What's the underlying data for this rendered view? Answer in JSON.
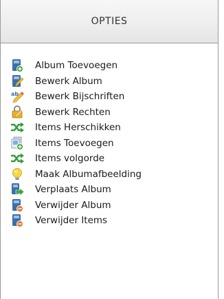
{
  "panel": {
    "title": "OPTIES"
  },
  "menu": {
    "items": [
      {
        "label": "Album Toevoegen",
        "icon": "album-add-icon"
      },
      {
        "label": "Bewerk Album",
        "icon": "album-edit-icon"
      },
      {
        "label": "Bewerk Bijschriften",
        "icon": "edit-captions-icon"
      },
      {
        "label": "Bewerk Rechten",
        "icon": "edit-permissions-icon"
      },
      {
        "label": "Items Herschikken",
        "icon": "shuffle-icon"
      },
      {
        "label": "Items Toevoegen",
        "icon": "items-add-icon"
      },
      {
        "label": "Items volgorde",
        "icon": "reorder-icon"
      },
      {
        "label": "Maak Albumafbeelding",
        "icon": "lightbulb-icon"
      },
      {
        "label": "Verplaats Album",
        "icon": "move-album-icon"
      },
      {
        "label": "Verwijder Album",
        "icon": "album-delete-icon"
      },
      {
        "label": "Verwijder Items",
        "icon": "items-delete-icon"
      }
    ]
  },
  "colors": {
    "header_bg": "#eeeeee",
    "border": "#9a9a9a",
    "text": "#1a1a1a",
    "book_blue": "#3d6fa8",
    "plus_green": "#3fa535",
    "minus_orange": "#e8782a",
    "pencil_yellow": "#f2c12e",
    "arrow_green": "#2f9e3a"
  }
}
